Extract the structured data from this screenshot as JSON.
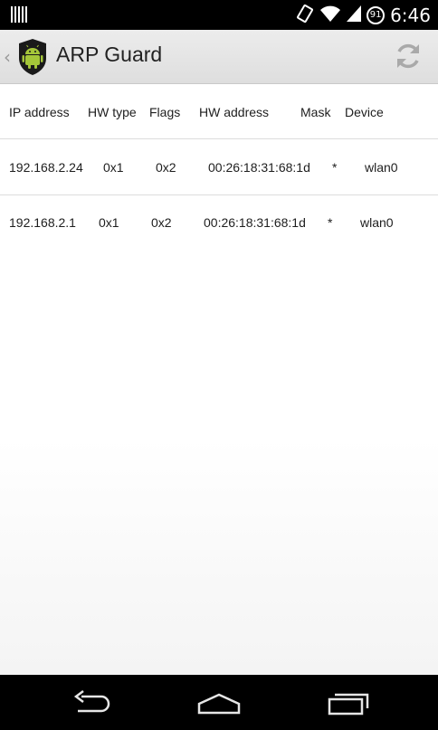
{
  "status_bar": {
    "time": "6:46",
    "battery": "91"
  },
  "action_bar": {
    "title": "ARP Guard"
  },
  "table": {
    "headers": [
      "IP address",
      "HW type",
      "Flags",
      "HW address",
      "Mask",
      "Device"
    ],
    "rows": [
      [
        "192.168.2.24",
        "0x1",
        "0x2",
        "00:26:18:31:68:1d",
        "*",
        "wlan0"
      ],
      [
        "192.168.2.1",
        "0x1",
        "0x2",
        "00:26:18:31:68:1d",
        "*",
        "wlan0"
      ]
    ]
  },
  "colors": {
    "android_green": "#a4c639",
    "shield": "#1a1a1a",
    "status_bar": "#000000"
  }
}
